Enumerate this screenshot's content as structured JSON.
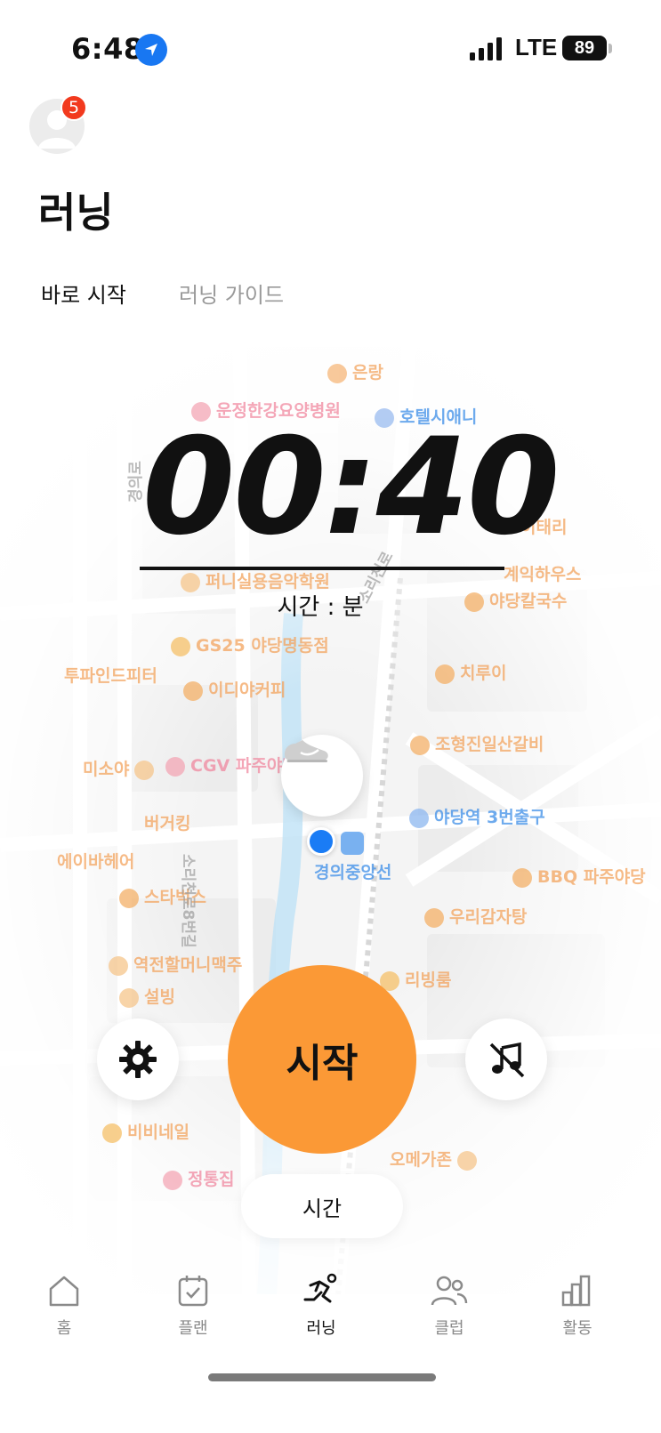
{
  "status_bar": {
    "time": "6:48",
    "network": "LTE",
    "battery": "89"
  },
  "header": {
    "notification_count": "5",
    "title": "러닝"
  },
  "tabs": [
    {
      "label": "바로 시작",
      "active": true
    },
    {
      "label": "러닝 가이드",
      "active": false
    }
  ],
  "map": {
    "labels": {
      "l1": "은랑",
      "l2": "운정한강요양병원",
      "l3": "호텔시애니",
      "l4": "퍼니실용음악학원",
      "l5": "GS25 야당명동점",
      "l6": "투파인드피터",
      "l7": "이디야커피",
      "l8": "치루이",
      "l9": "야당칼국수",
      "l10": "이태리",
      "l11": "계익하우스",
      "l12": "조형진일산갈비",
      "l13": "미소야",
      "l14": "CGV 파주야당",
      "l15": "야당역 3번출구",
      "l16": "버거킹",
      "l17": "경의중앙선",
      "l18": "에이바헤어",
      "l19": "BBQ 파주야당",
      "l20": "스타벅스",
      "l21": "소리천로8번길",
      "l22": "우리감자탕",
      "l23": "역전할머니맥주",
      "l24": "설빙",
      "l25": "리빙룸",
      "l26": "비비네일",
      "l27": "오메가존",
      "l28": "정통집",
      "l29": "소리천로",
      "l30": "경의로"
    }
  },
  "timer": {
    "value": "00:40",
    "unit_label": "시간 : 분"
  },
  "controls": {
    "start_label": "시작",
    "mode_label": "시간"
  },
  "tab_bar": [
    {
      "label": "홈",
      "icon": "home-icon"
    },
    {
      "label": "플랜",
      "icon": "plan-icon"
    },
    {
      "label": "러닝",
      "icon": "running-icon",
      "active": true
    },
    {
      "label": "클럽",
      "icon": "club-icon"
    },
    {
      "label": "활동",
      "icon": "activity-icon"
    }
  ],
  "colors": {
    "start_button": "#fb9936",
    "location_dot": "#1a7cf5",
    "badge": "#f23a1e"
  }
}
